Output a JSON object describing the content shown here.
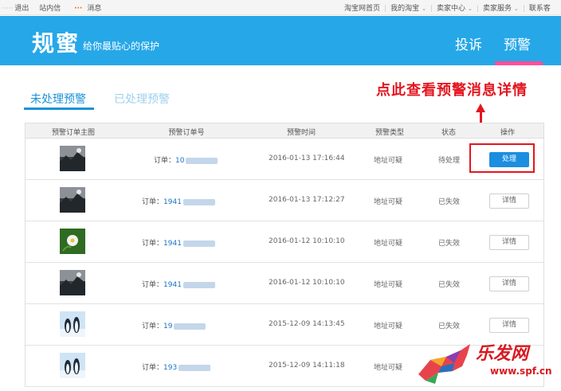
{
  "topbar": {
    "username_masked": "·····",
    "logout": "退出",
    "inbox": "站内信",
    "msg_dots": "···",
    "messages": "消息",
    "links": [
      {
        "label": "淘宝网首页",
        "caret": false
      },
      {
        "label": "我的淘宝",
        "caret": true
      },
      {
        "label": "卖家中心",
        "caret": true
      },
      {
        "label": "卖家服务",
        "caret": true
      },
      {
        "label": "联系客",
        "caret": false
      }
    ]
  },
  "header": {
    "brand": "规蜜",
    "slogan": "给你最贴心的保护",
    "nav_complain": "投诉",
    "nav_warning": "预警",
    "bg_color": "#26a7e8"
  },
  "tabs": {
    "unprocessed": "未处理预警",
    "processed": "已处理预警"
  },
  "annotation": {
    "text": "点此查看预警消息详情"
  },
  "table": {
    "headers": [
      "预警订单主图",
      "预警订单号",
      "预警时间",
      "预警类型",
      "状态",
      "操作"
    ],
    "order_label": "订单：",
    "rows": [
      {
        "order_num": "10",
        "time": "2016-01-13 17:16:44",
        "type": "地址可疑",
        "status": "待处理",
        "action": "处理",
        "primary": true,
        "thumb": "dark-landscape"
      },
      {
        "order_num": "1941",
        "time": "2016-01-13 17:12:27",
        "type": "地址可疑",
        "status": "已失效",
        "action": "详情",
        "primary": false,
        "thumb": "dark-landscape"
      },
      {
        "order_num": "1941",
        "time": "2016-01-12 10:10:10",
        "type": "地址可疑",
        "status": "已失效",
        "action": "详情",
        "primary": false,
        "thumb": "flower"
      },
      {
        "order_num": "1941",
        "time": "2016-01-12 10:10:10",
        "type": "地址可疑",
        "status": "已失效",
        "action": "详情",
        "primary": false,
        "thumb": "dark-landscape"
      },
      {
        "order_num": "19",
        "time": "2015-12-09 14:13:45",
        "type": "地址可疑",
        "status": "已失效",
        "action": "详情",
        "primary": false,
        "thumb": "penguins"
      },
      {
        "order_num": "193",
        "time": "2015-12-09 14:11:18",
        "type": "地址可疑",
        "status": "",
        "action": "",
        "primary": false,
        "thumb": "penguins"
      }
    ]
  },
  "watermark": {
    "title": "乐发网",
    "url": "www.spf.cn"
  }
}
